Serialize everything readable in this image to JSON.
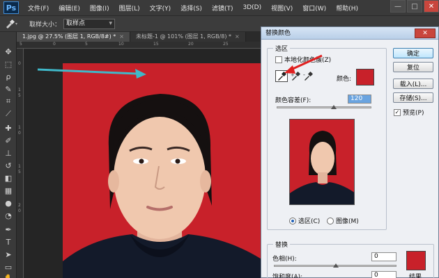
{
  "app": {
    "logo": "Ps",
    "menu": [
      "文件(F)",
      "编辑(E)",
      "图像(I)",
      "图层(L)",
      "文字(Y)",
      "选择(S)",
      "滤镜(T)",
      "3D(D)",
      "视图(V)",
      "窗口(W)",
      "帮助(H)"
    ],
    "window_controls": {
      "minimize": "—",
      "maximize": "□",
      "close": "✕"
    }
  },
  "options_bar": {
    "sample_size_label": "取样大小：",
    "sample_size_value": "取样点"
  },
  "tabs": [
    {
      "label": "1.jpg @ 27.5% (图层 1, RGB/8#) *",
      "close": "×"
    },
    {
      "label": "未标题-1 @ 101% (图层 1, RGB/8) *",
      "close": "×"
    }
  ],
  "toolbar": {
    "icons": [
      "move-icon",
      "marquee-icon",
      "lasso-icon",
      "quick-select-icon",
      "crop-icon",
      "eyedropper-icon",
      "healing-icon",
      "brush-icon",
      "stamp-icon",
      "history-brush-icon",
      "eraser-icon",
      "gradient-icon",
      "blur-icon",
      "dodge-icon",
      "pen-icon",
      "type-icon",
      "path-select-icon",
      "shape-icon",
      "hand-icon"
    ]
  },
  "rulers": {
    "h": [
      "5",
      "0",
      "5",
      "10",
      "15",
      "20",
      "25"
    ],
    "v": [
      "0",
      "1",
      "5",
      "1",
      "0",
      "1",
      "5",
      "2",
      "0"
    ]
  },
  "dialog": {
    "title": "替换颜色",
    "selection_group": "选区",
    "localized_clusters_label": "本地化颜色簇(Z)",
    "localized_clusters_checked": false,
    "color_label": "颜色:",
    "fuzziness_label": "颜色容差(F):",
    "fuzziness_value": "120",
    "fuzziness_fraction": 0.6,
    "radio_selection": "选区(C)",
    "radio_image": "图像(M)",
    "replace_group": "替换",
    "hue_label": "色相(H):",
    "hue_value": "0",
    "saturation_label": "饱和度(A):",
    "saturation_value": "0",
    "result_label": "结果",
    "buttons": {
      "ok": "确定",
      "reset": "复位",
      "load": "载入(L)...",
      "save": "存储(S)..."
    },
    "preview_label": "预览(P)",
    "preview_checked": true
  },
  "colors": {
    "background_red": "#c8212a",
    "annotation_teal": "#3fb8c9",
    "annotation_red": "#e02020"
  }
}
